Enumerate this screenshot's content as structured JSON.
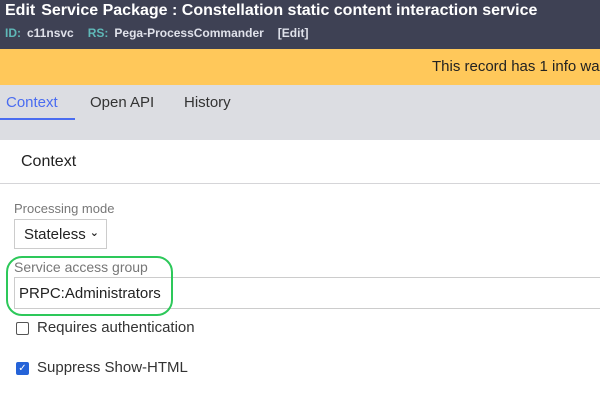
{
  "header": {
    "edit_label": "Edit",
    "title": "Service Package : Constellation static content interaction service",
    "id_label": "ID:",
    "id_value": "c11nsvc",
    "rs_label": "RS:",
    "rs_value": "Pega-ProcessCommander",
    "edit_link": "[Edit]"
  },
  "banner": {
    "text": "This record has 1 info wa"
  },
  "tabs": [
    {
      "label": "Context",
      "active": true
    },
    {
      "label": "Open API"
    },
    {
      "label": "History"
    }
  ],
  "section": {
    "title": "Context"
  },
  "fields": {
    "processing_mode_label": "Processing mode",
    "processing_mode_value": "Stateless",
    "access_group_label": "Service access group",
    "access_group_value": "PRPC:Administrators"
  },
  "checkboxes": [
    {
      "label": "Requires authentication",
      "checked": false
    },
    {
      "label": "Suppress Show-HTML",
      "checked": true
    }
  ],
  "colors": {
    "header": "#3e4154",
    "banner": "#ffc85a",
    "accent": "#4a6cf0",
    "highlight": "#2dc85a"
  }
}
